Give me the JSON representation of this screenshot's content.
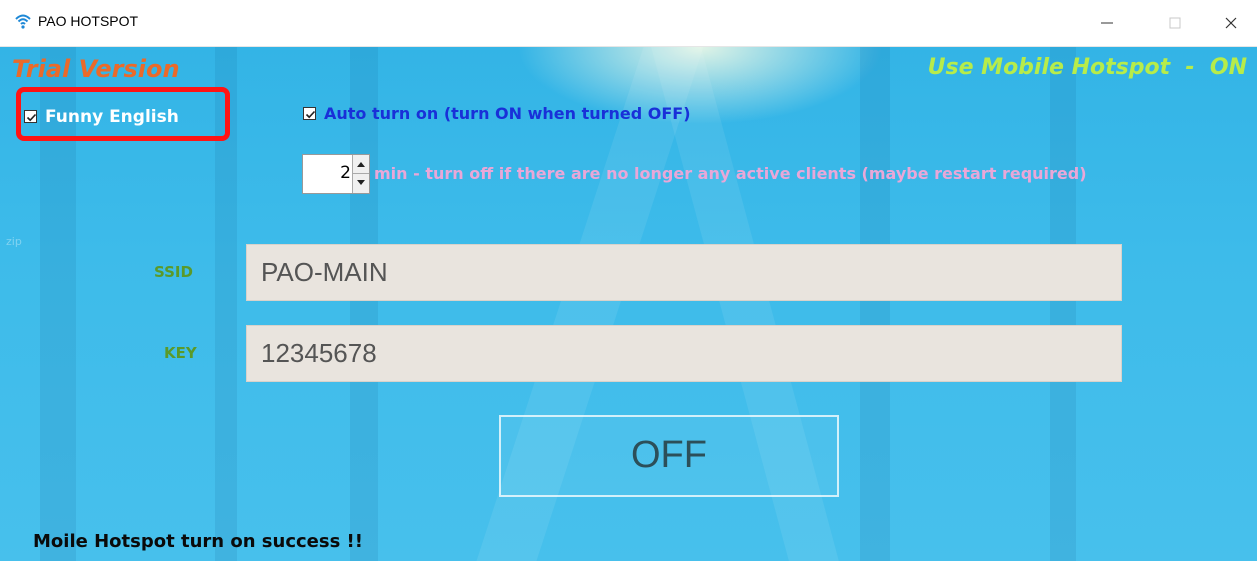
{
  "window": {
    "title": "PAO HOTSPOT",
    "icons": {
      "app": "wifi-icon",
      "minimize": "minimize-icon",
      "maximize": "maximize-icon",
      "close": "close-icon"
    }
  },
  "header": {
    "trial_label": "Trial Version",
    "mobile_hotspot_status": "Use Mobile Hotspot  -  ON"
  },
  "options": {
    "funny_english": {
      "label": "Funny English",
      "checked": true
    },
    "auto_turn_on": {
      "label": "Auto turn on (turn ON when turned OFF)",
      "checked": true
    },
    "idle_minutes": {
      "value": "2",
      "label": "min - turn off if there are no longer any active clients (maybe restart required)"
    }
  },
  "form": {
    "ssid_label": "SSID",
    "ssid_value": "PAO-MAIN",
    "key_label": "KEY",
    "key_value": "12345678"
  },
  "toggle_button": {
    "label": "OFF"
  },
  "status_text": "Moile Hotspot turn on success !!",
  "colors": {
    "background": "#3dbbea",
    "trial": "#ea6a2a",
    "hotspot_status": "#b7ec4a",
    "auto_label": "#1930d8",
    "minutes_label": "#e9a7d8",
    "field_label": "#5a9a2a",
    "highlight": "#ff1414"
  }
}
